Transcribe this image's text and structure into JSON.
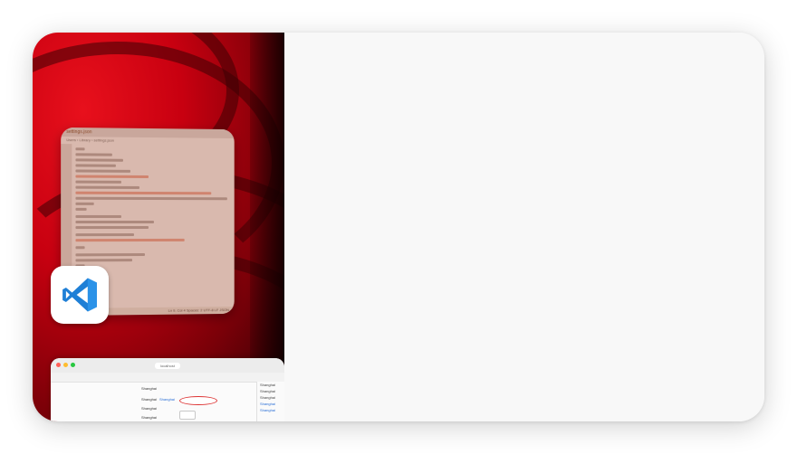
{
  "left_pane": {
    "editor_window": {
      "tab_label": "settings.json",
      "breadcrumb": "Users › Library › settings.json",
      "status_text": "Ln 9, Col 4  Spaces: 2  UTF-8  LF  JSON"
    },
    "app_icon": {
      "icon": "vscode-icon",
      "color": "#1f7ed6"
    },
    "browser_window": {
      "url": "localhost",
      "form_rows": [
        {
          "label": "Shanghai"
        },
        {
          "label": "Shanghai",
          "link": "Shanghai"
        },
        {
          "label": "Shanghai"
        },
        {
          "label": "Shanghai"
        }
      ],
      "side_lines": [
        {
          "text": "Shanghai"
        },
        {
          "text": "Shanghai"
        },
        {
          "text": "Shanghai"
        },
        {
          "text": "Shanghai",
          "link": true
        },
        {
          "text": "Shanghai",
          "link": true
        }
      ]
    }
  },
  "right_pane": {}
}
